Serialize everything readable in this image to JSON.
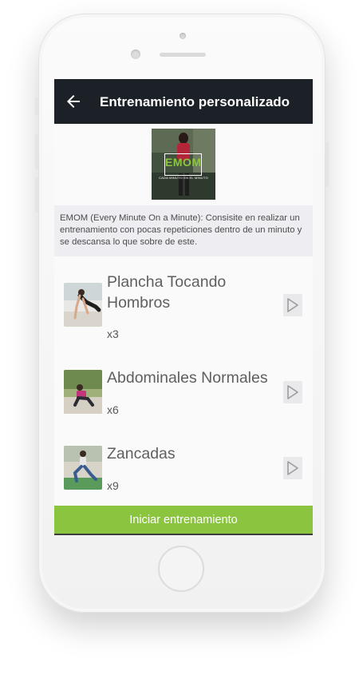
{
  "header": {
    "title": "Entrenamiento personalizado",
    "back_icon": "arrow-left-icon"
  },
  "banner": {
    "title": "EMOM",
    "subtitle": "CADA MINUTO EN EL MINUTO"
  },
  "description": "EMOM (Every Minute On a Minute): Consisite en realizar un entrenamiento con pocas repeticiones dentro de un minuto y se descansa lo que sobre de este.",
  "exercises": [
    {
      "name": "Plancha Tocando Hombros",
      "reps": "x3",
      "action_icon": "play-icon"
    },
    {
      "name": "Abdominales Normales",
      "reps": "x6",
      "action_icon": "play-icon"
    },
    {
      "name": "Zancadas",
      "reps": "x9",
      "action_icon": "play-icon"
    }
  ],
  "start_button": "Iniciar entrenamiento",
  "colors": {
    "appbar": "#1c2127",
    "accent": "#8bc540",
    "description_bg": "#eeeef2"
  }
}
